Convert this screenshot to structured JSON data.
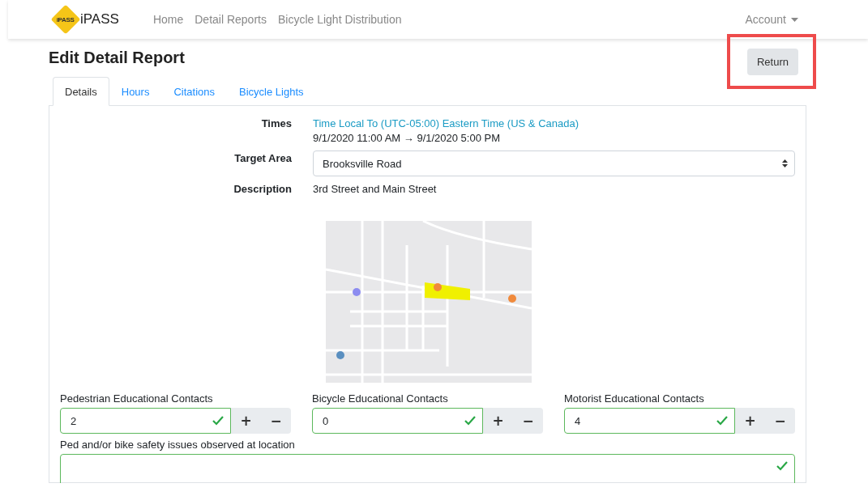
{
  "navbar": {
    "brand_badge": "iPASS",
    "brand": "iPASS",
    "links": [
      "Home",
      "Detail Reports",
      "Bicycle Light Distribution"
    ],
    "account": "Account"
  },
  "page": {
    "title": "Edit Detail Report",
    "return_button": "Return",
    "return_highlighted": true
  },
  "tabs": [
    {
      "label": "Details",
      "selected": true
    },
    {
      "label": "Hours",
      "selected": false
    },
    {
      "label": "Citations",
      "selected": false
    },
    {
      "label": "Bicycle Lights",
      "selected": false
    }
  ],
  "details": {
    "times_label": "Times",
    "times_zone": "Time Local To (UTC-05:00) Eastern Time (US & Canada)",
    "times_range": "9/1/2020 11:00 AM → 9/1/2020 5:00 PM",
    "target_area_label": "Target Area",
    "target_area": "Brooksville Road",
    "description_label": "Description",
    "description": "3rd Street and Main Street"
  },
  "counters": [
    {
      "label": "Pedestrian Educational Contacts",
      "value": "2",
      "valid": true,
      "plus": "+",
      "minus": "−"
    },
    {
      "label": "Bicycle Educational Contacts",
      "value": "0",
      "valid": true,
      "plus": "+",
      "minus": "−"
    },
    {
      "label": "Motorist Educational Contacts",
      "value": "4",
      "valid": true,
      "plus": "+",
      "minus": "−"
    }
  ],
  "issues": {
    "label": "Ped and/or bike safety issues observed at location",
    "valid": true
  }
}
